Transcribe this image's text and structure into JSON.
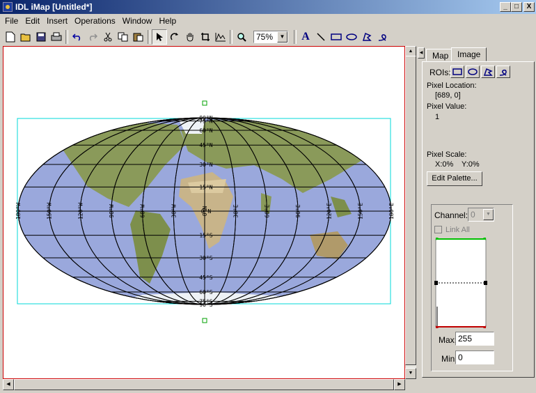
{
  "window": {
    "title": "IDL iMap [Untitled*]",
    "buttons": [
      "_",
      "□",
      "X"
    ]
  },
  "menu": [
    "File",
    "Edit",
    "Insert",
    "Operations",
    "Window",
    "Help"
  ],
  "toolbar": {
    "icons": [
      "new-file-icon",
      "open-folder-icon",
      "save-icon",
      "print-icon",
      "undo-icon",
      "redo-icon",
      "cut-icon",
      "copy-icon",
      "paste-icon",
      "select-arrow-icon",
      "rotate-icon",
      "pan-hand-icon",
      "crop-icon",
      "data-range-icon",
      "zoom-magnifier-icon",
      "text-icon",
      "line-icon",
      "rectangle-icon",
      "oval-icon",
      "polygon-icon",
      "freehand-icon"
    ],
    "zoom": "75%"
  },
  "map": {
    "lon_labels": [
      "180°W",
      "150°W",
      "120°W",
      "90°W",
      "60°W",
      "30°W",
      "0°N",
      "30°E",
      "60°E",
      "90°E",
      "120°E",
      "150°E",
      "180°E"
    ],
    "lat_labels": [
      "90°N",
      "75°N",
      "60°N",
      "45°N",
      "30°N",
      "15°N",
      "0°N",
      "15°S",
      "30°S",
      "45°S",
      "60°S",
      "75°S",
      "90°S"
    ],
    "colors": {
      "ocean": "#99a7dc",
      "land": "#8a9a5a",
      "selection": "#00e0e0",
      "handle": "#00a000"
    }
  },
  "panel": {
    "tabs": [
      "Map",
      "Image"
    ],
    "active_tab": "Image",
    "rois_label": "ROIs:",
    "pixel_location_label": "Pixel Location:",
    "pixel_location_value": "[689, 0]",
    "pixel_value_label": "Pixel Value:",
    "pixel_value": "1",
    "pixel_scale_label": "Pixel Scale:",
    "pixel_scale_x": "X:0%",
    "pixel_scale_y": "Y:0%",
    "edit_palette": "Edit Palette...",
    "channel_label": "Channel:",
    "channel_value": "0",
    "link_all": "Link All",
    "max_label": "Max:",
    "max_value": "255",
    "min_label": "Min:",
    "min_value": "0"
  }
}
